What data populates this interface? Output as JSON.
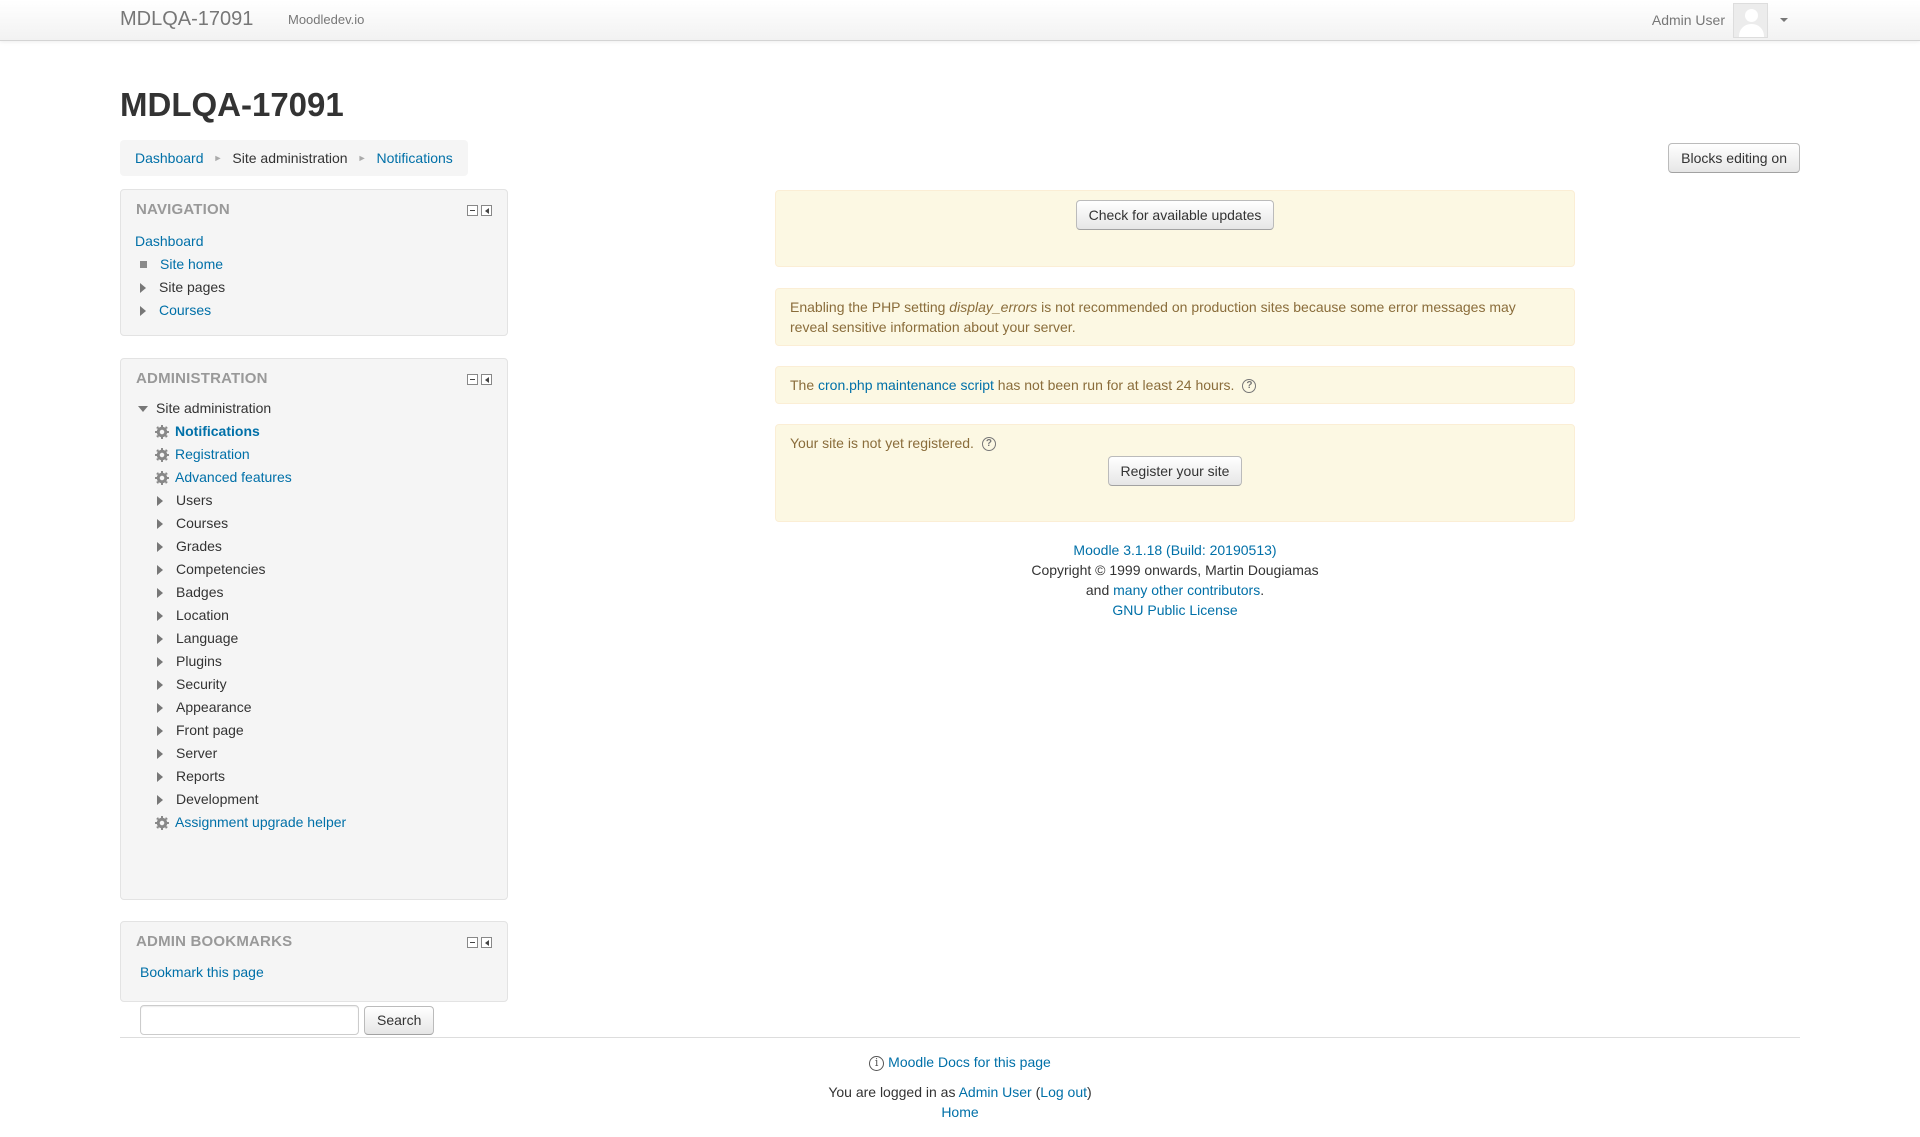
{
  "navbar": {
    "brand": "MDLQA-17091",
    "site_link": "Moodledev.io",
    "user_name": "Admin User"
  },
  "header": {
    "title": "MDLQA-17091",
    "breadcrumb": [
      "Dashboard",
      "Site administration",
      "Notifications"
    ],
    "blocks_editing_button": "Blocks editing on"
  },
  "navigation_block": {
    "title": "NAVIGATION",
    "dashboard": "Dashboard",
    "items": [
      "Site home",
      "Site pages",
      "Courses"
    ]
  },
  "administration_block": {
    "title": "ADMINISTRATION",
    "root": "Site administration",
    "gear_items": [
      "Notifications",
      "Registration",
      "Advanced features"
    ],
    "categories": [
      "Users",
      "Courses",
      "Grades",
      "Competencies",
      "Badges",
      "Location",
      "Language",
      "Plugins",
      "Security",
      "Appearance",
      "Front page",
      "Server",
      "Reports",
      "Development"
    ],
    "assignment_helper": "Assignment upgrade helper",
    "search_button": "Search",
    "search_value": ""
  },
  "bookmarks_block": {
    "title": "ADMIN BOOKMARKS",
    "link": "Bookmark this page"
  },
  "notifications": {
    "check_updates_button": "Check for available updates",
    "php_warning": {
      "prefix": "Enabling the PHP setting ",
      "setting": "display_errors",
      "suffix_line1": " is not recommended on production sites because some error messages may",
      "line2": "reveal sensitive information about your server."
    },
    "cron": {
      "prefix": "The ",
      "link": "cron.php maintenance script",
      "suffix": " has not been run for at least 24 hours."
    },
    "registration": {
      "text": "Your site is not yet registered.",
      "button": "Register your site"
    }
  },
  "version_info": {
    "version_link": "Moodle 3.1.18 (Build: 20190513)",
    "copyright": "Copyright © 1999 onwards, Martin Dougiamas",
    "and": "and ",
    "contributors_link": "many other contributors",
    "period": ".",
    "license_link": "GNU Public License"
  },
  "footer": {
    "docs_link": "Moodle Docs for this page",
    "logged_in_prefix": "You are logged in as ",
    "user_link": "Admin User",
    "open_paren": " (",
    "logout_link": "Log out",
    "close_paren": ")",
    "home_link": "Home"
  },
  "colors": {
    "link": "#0070a8",
    "alert_bg": "#fcf8e3",
    "alert_text": "#8a6d3b",
    "block_bg": "#f5f5f5"
  }
}
